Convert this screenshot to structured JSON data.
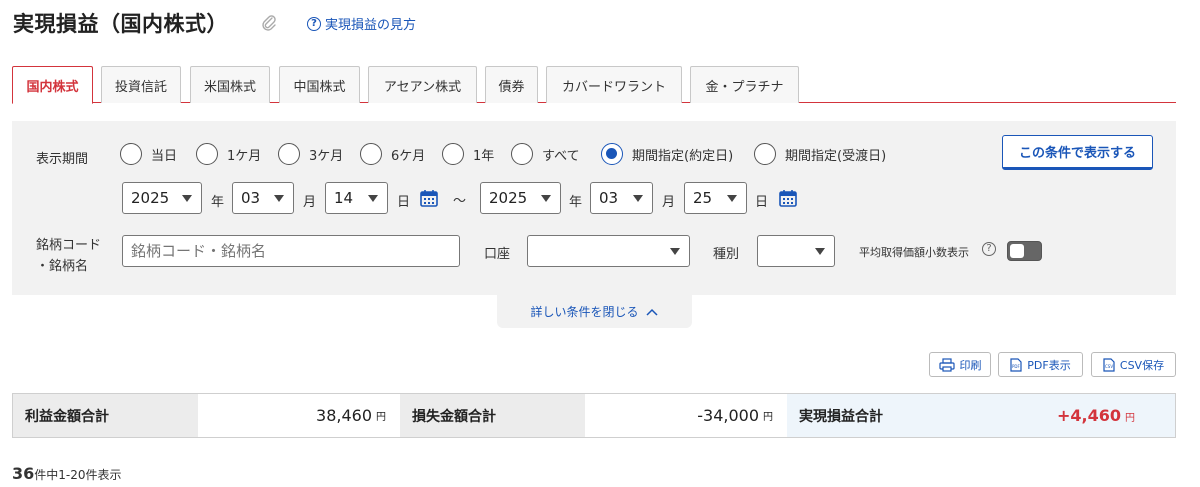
{
  "page": {
    "title": "実現損益（国内株式）",
    "help_link": "実現損益の見方"
  },
  "tabs": [
    {
      "label": "国内株式",
      "active": true
    },
    {
      "label": "投資信託"
    },
    {
      "label": "米国株式"
    },
    {
      "label": "中国株式"
    },
    {
      "label": "アセアン株式"
    },
    {
      "label": "債券"
    },
    {
      "label": "カバードワラント"
    },
    {
      "label": "金・プラチナ"
    }
  ],
  "filters": {
    "period_label": "表示期間",
    "period_options": [
      "当日",
      "1ケ月",
      "3ケ月",
      "6ケ月",
      "1年",
      "すべて",
      "期間指定(約定日)",
      "期間指定(受渡日)"
    ],
    "selected_period": "期間指定(約定日)",
    "submit_button": "この条件で表示する",
    "from": {
      "year": "2025",
      "month": "03",
      "day": "14"
    },
    "to": {
      "year": "2025",
      "month": "03",
      "day": "25"
    },
    "unit_year": "年",
    "unit_month": "月",
    "unit_day": "日",
    "range_sep": "～",
    "code_label_1": "銘柄コード",
    "code_label_2": "・銘柄名",
    "code_placeholder": "銘柄コード・銘柄名",
    "account_label": "口座",
    "account_value": "",
    "type_label": "種別",
    "type_value": "",
    "decimal_label": "平均取得価額小数表示",
    "decimal_on": false,
    "collapse_label": "詳しい条件を閉じる"
  },
  "actions": {
    "print": "印刷",
    "pdf": "PDF表示",
    "csv": "CSV保存"
  },
  "summary": {
    "profit_label": "利益金額合計",
    "profit_value": "38,460",
    "loss_label": "損失金額合計",
    "loss_value": "-34,000",
    "net_label": "実現損益合計",
    "net_value": "+4,460",
    "yen": "円"
  },
  "results": {
    "total": "36",
    "range_text": "件中1-20件表示"
  },
  "colors": {
    "accent": "#d3343c",
    "link": "#1a56b8"
  }
}
